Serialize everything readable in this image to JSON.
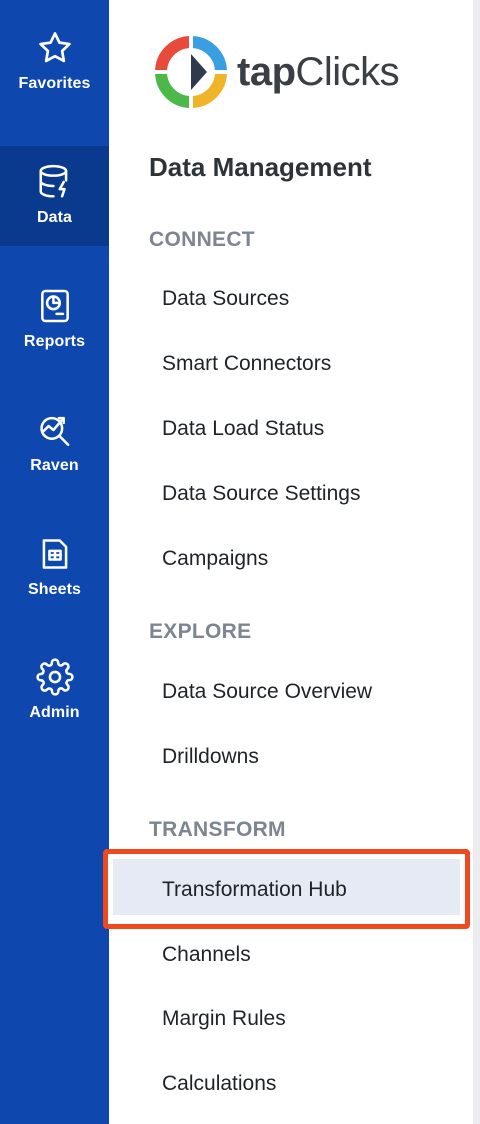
{
  "rail": {
    "items": [
      {
        "label": "Favorites",
        "icon": "star-icon",
        "active": false
      },
      {
        "label": "Data",
        "icon": "database-icon",
        "active": true
      },
      {
        "label": "Reports",
        "icon": "report-icon",
        "active": false
      },
      {
        "label": "Raven",
        "icon": "raven-insights-icon",
        "active": false
      },
      {
        "label": "Sheets",
        "icon": "sheet-icon",
        "active": false
      },
      {
        "label": "Admin",
        "icon": "gear-icon",
        "active": false
      }
    ]
  },
  "logo": {
    "text_bold": "tap",
    "text_regular": "Clicks"
  },
  "panel": {
    "title": "Data Management",
    "sections": [
      {
        "title": "CONNECT",
        "items": [
          "Data Sources",
          "Smart Connectors",
          "Data Load Status",
          "Data Source Settings",
          "Campaigns"
        ]
      },
      {
        "title": "EXPLORE",
        "items": [
          "Data Source Overview",
          "Drilldowns"
        ]
      },
      {
        "title": "TRANSFORM",
        "items": [
          "Transformation Hub",
          "Channels",
          "Margin Rules",
          "Calculations"
        ]
      }
    ],
    "selected_item": "Transformation Hub"
  },
  "colors": {
    "rail_bg": "#0e47ad",
    "rail_active_bg": "#0a3a8e",
    "highlight_border": "#f0491f",
    "selected_bg": "#e6eaf5",
    "logo_ring": [
      "#3a9fe0",
      "#f0b429",
      "#e84a3c",
      "#4cb84a"
    ]
  }
}
